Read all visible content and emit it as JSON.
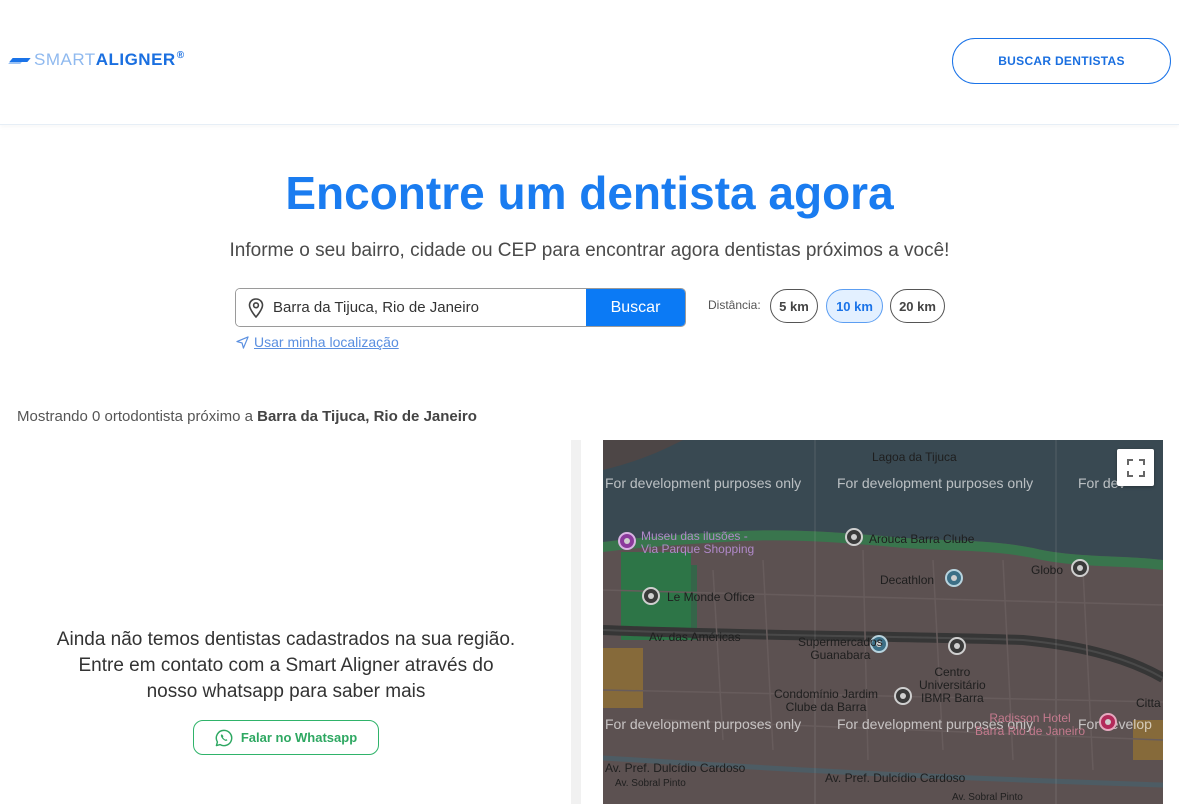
{
  "header": {
    "logo_smart": "SMART",
    "logo_aligner": "ALIGNER",
    "logo_reg": "®",
    "cta_label": "BUSCAR DENTISTAS"
  },
  "hero": {
    "title": "Encontre um dentista agora",
    "subtitle": "Informe o seu bairro, cidade ou CEP para encontrar agora dentistas próximos a você!"
  },
  "search": {
    "value": "Barra da Tijuca, Rio de Janeiro",
    "button_label": "Buscar",
    "use_location_label": "Usar minha localização"
  },
  "distance": {
    "label": "Distância:",
    "options": [
      "5 km",
      "10 km",
      "20 km"
    ],
    "selected": "10 km"
  },
  "results": {
    "prefix": "Mostrando 0 ortodontista próximo a ",
    "location": "Barra da Tijuca, Rio de Janeiro"
  },
  "empty_state": {
    "line1": "Ainda não temos dentistas cadastrados na sua região.",
    "line2": "Entre em contato com a Smart Aligner através do",
    "line3": "nosso whatsapp para saber mais",
    "whatsapp_label": "Falar no Whatsapp"
  },
  "map": {
    "watermark": "For development purposes only",
    "watermark_clipped": "For dev",
    "watermark_clipped2": "For develop",
    "labels": {
      "lagoa": "Lagoa da Tijuca",
      "museu1": "Museu das ilusões -",
      "museu2": "Via Parque Shopping",
      "arouca": "Arouca Barra Clube",
      "decathlon": "Decathlon",
      "globo": "Globo",
      "lemonde": "Le Monde Office",
      "americas": "Av. das Américas",
      "super1": "Supermercados",
      "super2": "Guanabara",
      "centro1": "Centro",
      "centro2": "Universitário",
      "centro3": "IBMR Barra",
      "condominio1": "Condomínio Jardim",
      "condominio2": "Clube da Barra",
      "citta": "Citta O",
      "radisson1": "Radisson Hotel",
      "radisson2": "Barra Rio de Janeiro",
      "dulcidio1": "Av. Pref. Dulcídio Cardoso",
      "dulcidio2": "Av. Pref. Dulcídio Cardoso",
      "sobral1": "Av. Sobral Pinto",
      "sobral2": "Av. Sobral Pinto"
    }
  },
  "colors": {
    "brand_blue": "#1a7cf0",
    "button_blue": "#0b7af5",
    "whatsapp_green": "#2fb36a",
    "map_water": "#3f5560",
    "map_land": "#6e5f5f"
  }
}
